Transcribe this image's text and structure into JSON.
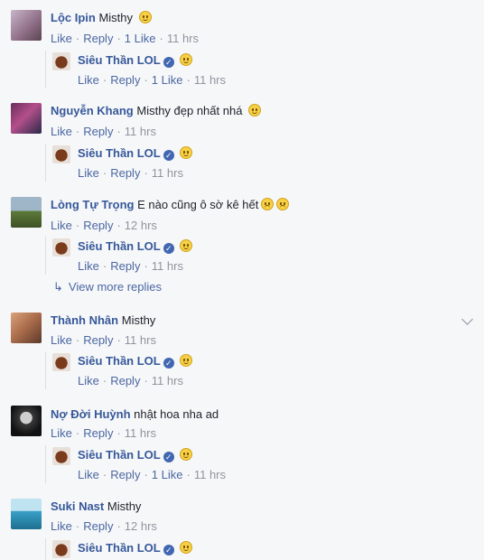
{
  "page_author": "Siêu Thần LOL",
  "actions": {
    "like": "Like",
    "reply": "Reply",
    "one_like": "1 Like",
    "view_more": "View more replies"
  },
  "comments": [
    {
      "author": "Lộc Ipin",
      "text": "Misthy",
      "time": "11 hrs",
      "likes": "1 Like",
      "reply": {
        "time": "11 hrs",
        "likes": "1 Like"
      }
    },
    {
      "author": "Nguyễn Khang",
      "text": "Misthy đẹp nhất nhá",
      "time": "11 hrs",
      "reply": {
        "time": "11 hrs"
      }
    },
    {
      "author": "Lòng Tự Trọng",
      "text": "E nào cũng ô sờ kê hết",
      "time": "12 hrs",
      "reply": {
        "time": "11 hrs"
      }
    },
    {
      "author": "Thành Nhân",
      "text": "Misthy",
      "time": "11 hrs",
      "reply": {
        "time": "11 hrs"
      }
    },
    {
      "author": "Nợ Đời Huỳnh",
      "text": "nhật hoa nha ad",
      "time": "11 hrs",
      "reply": {
        "time": "11 hrs",
        "likes": "1 Like"
      }
    },
    {
      "author": "Suki Nast",
      "text": "Misthy",
      "time": "12 hrs",
      "reply": {}
    }
  ],
  "colors": {
    "link": "#365899",
    "meta": "#90949c",
    "background": "#f6f7f9"
  }
}
